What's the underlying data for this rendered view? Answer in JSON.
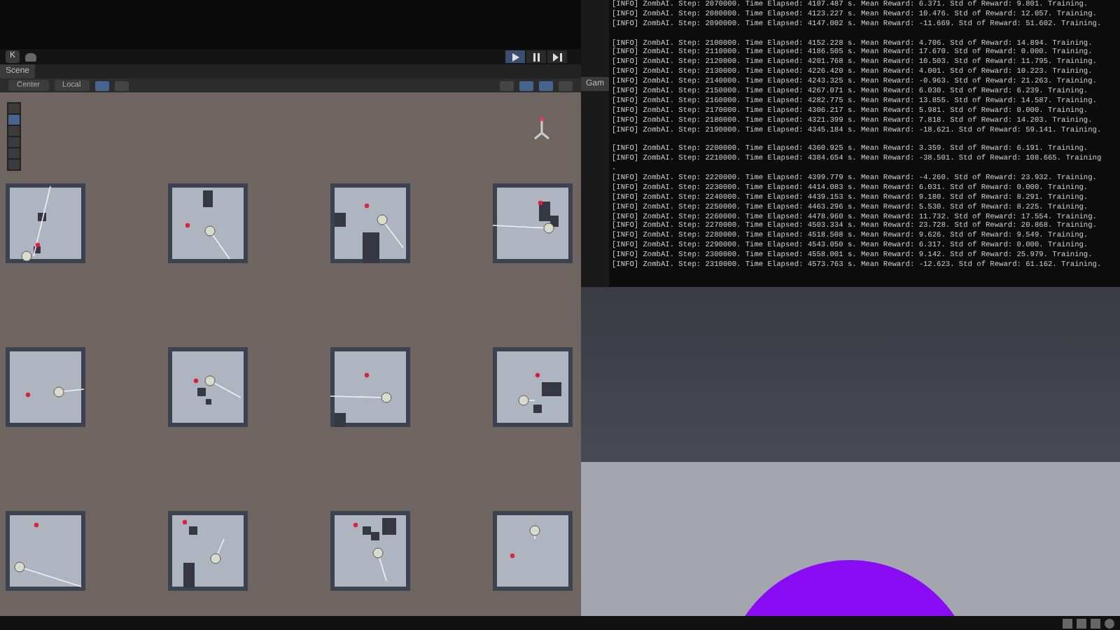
{
  "editor_toolbar": {
    "account": "K",
    "play_controls": [
      {
        "kind": "play",
        "selected": true
      },
      {
        "kind": "pause",
        "selected": false
      },
      {
        "kind": "step",
        "selected": false
      }
    ]
  },
  "scene_tab": {
    "label": "Scene"
  },
  "game_tab": {
    "label": "Gam"
  },
  "scene_toolbar": {
    "pivot": "Center",
    "space": "Local"
  },
  "console": {
    "lines": [
      {
        "kind": "text",
        "text": "[INFO] ZombAI. Step: 2070000. Time Elapsed: 4107.487 s. Mean Reward: 6.371. Std of Reward: 9.801. Training."
      },
      {
        "kind": "text",
        "text": "[INFO] ZombAI. Step: 2080000. Time Elapsed: 4123.227 s. Mean Reward: 10.476. Std of Reward: 12.057. Training."
      },
      {
        "kind": "text",
        "text": "[INFO] ZombAI. Step: 2090000. Time Elapsed: 4147.002 s. Mean Reward: -11.669. Std of Reward: 51.602. Training."
      },
      {
        "kind": "blank"
      },
      {
        "kind": "text",
        "text": "[INFO] ZombAI. Step: 2100000. Time Elapsed: 4152.228 s. Mean Reward: 4.706. Std of Reward: 14.894. Training."
      },
      {
        "kind": "text",
        "text": "[INFO] ZombAI. Step: 2110000. Time Elapsed: 4186.505 s. Mean Reward: 17.670. Std of Reward: 0.000. Training."
      },
      {
        "kind": "text",
        "text": "[INFO] ZombAI. Step: 2120000. Time Elapsed: 4201.768 s. Mean Reward: 10.503. Std of Reward: 11.795. Training."
      },
      {
        "kind": "text",
        "text": "[INFO] ZombAI. Step: 2130000. Time Elapsed: 4226.420 s. Mean Reward: 4.001. Std of Reward: 10.223. Training."
      },
      {
        "kind": "text",
        "text": "[INFO] ZombAI. Step: 2140000. Time Elapsed: 4243.325 s. Mean Reward: -0.963. Std of Reward: 21.263. Training."
      },
      {
        "kind": "text",
        "text": "[INFO] ZombAI. Step: 2150000. Time Elapsed: 4267.071 s. Mean Reward: 6.030. Std of Reward: 6.239. Training."
      },
      {
        "kind": "text",
        "text": "[INFO] ZombAI. Step: 2160000. Time Elapsed: 4282.775 s. Mean Reward: 13.855. Std of Reward: 14.587. Training."
      },
      {
        "kind": "text",
        "text": "[INFO] ZombAI. Step: 2170000. Time Elapsed: 4306.217 s. Mean Reward: 5.981. Std of Reward: 0.000. Training."
      },
      {
        "kind": "text",
        "text": "[INFO] ZombAI. Step: 2180000. Time Elapsed: 4321.399 s. Mean Reward: 7.818. Std of Reward: 14.203. Training."
      },
      {
        "kind": "text",
        "text": "[INFO] ZombAI. Step: 2190000. Time Elapsed: 4345.184 s. Mean Reward: -18.621. Std of Reward: 59.141. Training."
      },
      {
        "kind": "blank"
      },
      {
        "kind": "text",
        "text": "[INFO] ZombAI. Step: 2200000. Time Elapsed: 4360.925 s. Mean Reward: 3.359. Std of Reward: 6.191. Training."
      },
      {
        "kind": "text",
        "text": "[INFO] ZombAI. Step: 2210000. Time Elapsed: 4384.654 s. Mean Reward: -38.501. Std of Reward: 108.665. Training"
      },
      {
        "kind": "text",
        "text": "."
      },
      {
        "kind": "text",
        "text": "[INFO] ZombAI. Step: 2220000. Time Elapsed: 4399.779 s. Mean Reward: -4.260. Std of Reward: 23.932. Training."
      },
      {
        "kind": "text",
        "text": "[INFO] ZombAI. Step: 2230000. Time Elapsed: 4414.083 s. Mean Reward: 6.031. Std of Reward: 0.000. Training."
      },
      {
        "kind": "text",
        "text": "[INFO] ZombAI. Step: 2240000. Time Elapsed: 4439.153 s. Mean Reward: 9.180. Std of Reward: 8.291. Training."
      },
      {
        "kind": "text",
        "text": "[INFO] ZombAI. Step: 2250000. Time Elapsed: 4463.296 s. Mean Reward: 5.530. Std of Reward: 8.225. Training."
      },
      {
        "kind": "text",
        "text": "[INFO] ZombAI. Step: 2260000. Time Elapsed: 4478.960 s. Mean Reward: 11.732. Std of Reward: 17.554. Training."
      },
      {
        "kind": "text",
        "text": "[INFO] ZombAI. Step: 2270000. Time Elapsed: 4503.334 s. Mean Reward: 23.728. Std of Reward: 20.868. Training."
      },
      {
        "kind": "text",
        "text": "[INFO] ZombAI. Step: 2280000. Time Elapsed: 4518.508 s. Mean Reward: 9.626. Std of Reward: 9.549. Training."
      },
      {
        "kind": "text",
        "text": "[INFO] ZombAI. Step: 2290000. Time Elapsed: 4543.050 s. Mean Reward: 6.317. Std of Reward: 0.000. Training."
      },
      {
        "kind": "text",
        "text": "[INFO] ZombAI. Step: 2300000. Time Elapsed: 4558.001 s. Mean Reward: 9.142. Std of Reward: 25.979. Training."
      },
      {
        "kind": "text",
        "text": "[INFO] ZombAI. Step: 2310000. Time Elapsed: 4573.763 s. Mean Reward: -12.623. Std of Reward: 61.162. Training."
      }
    ]
  }
}
